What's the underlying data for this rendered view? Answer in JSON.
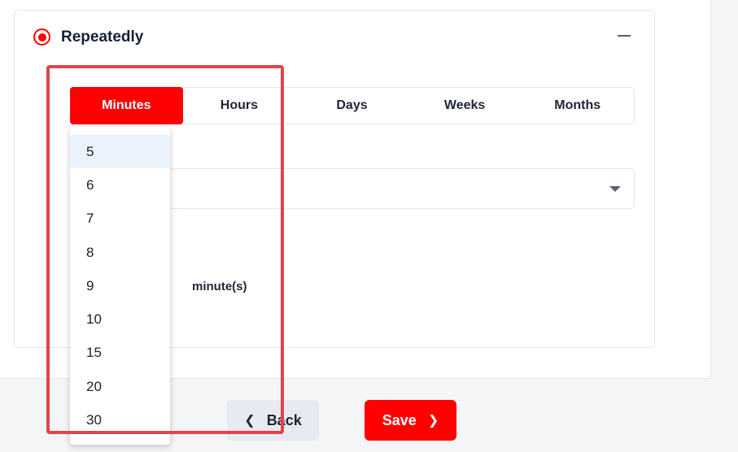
{
  "section": {
    "title": "Repeatedly",
    "radio_selected": true
  },
  "tabs": [
    {
      "label": "Minutes",
      "active": true
    },
    {
      "label": "Hours",
      "active": false
    },
    {
      "label": "Days",
      "active": false
    },
    {
      "label": "Weeks",
      "active": false
    },
    {
      "label": "Months",
      "active": false
    }
  ],
  "interval": {
    "unit_label": "minute(s)",
    "options": [
      "5",
      "6",
      "7",
      "8",
      "9",
      "10",
      "15",
      "20",
      "30"
    ],
    "highlighted": "5"
  },
  "footer": {
    "back_label": "Back",
    "save_label": "Save"
  },
  "colors": {
    "accent": "#ff0000",
    "annotation_box": "#e0454a",
    "option_hover": "#eaf2fb"
  }
}
